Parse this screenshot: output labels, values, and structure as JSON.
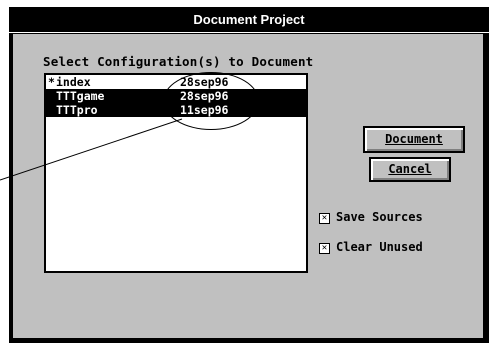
{
  "dialog": {
    "title": "Document Project",
    "prompt": "Select Configuration(s) to Document",
    "list": {
      "items": [
        {
          "mark": "*",
          "name": "index",
          "date": "28sep96",
          "selected": false
        },
        {
          "mark": "",
          "name": "TTTgame",
          "date": "28sep96",
          "selected": true
        },
        {
          "mark": "",
          "name": "TTTpro",
          "date": "11sep96",
          "selected": true
        }
      ]
    },
    "buttons": {
      "document": "Document",
      "cancel": "Cancel"
    },
    "options": {
      "save_sources": {
        "label": "Save Sources",
        "checked": true,
        "check_glyph": "✕"
      },
      "clear_unused": {
        "label": "Clear Unused",
        "checked": true,
        "check_glyph": "✕"
      }
    }
  },
  "colors": {
    "frame": "#000000",
    "client": "#c0c0c0",
    "list_bg": "#ffffff",
    "selection": "#000000"
  }
}
